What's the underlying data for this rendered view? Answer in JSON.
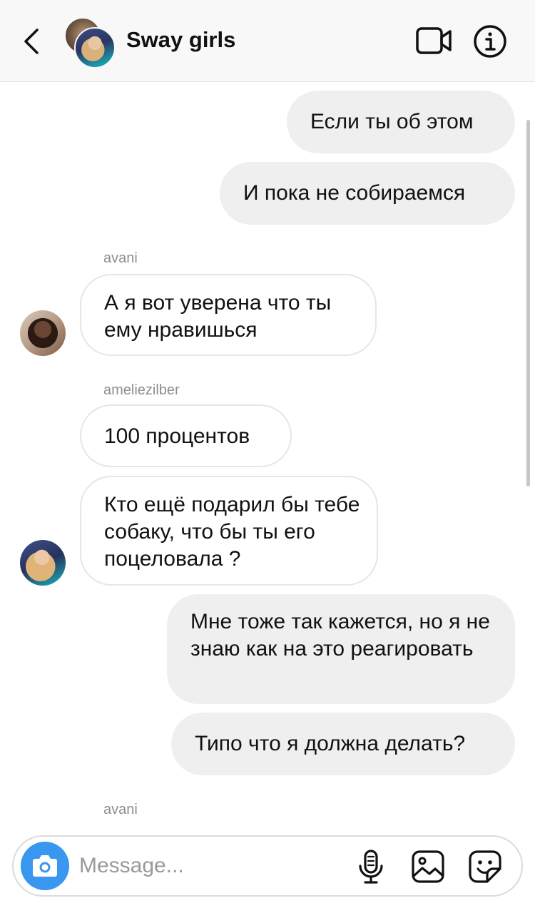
{
  "header": {
    "title": "Sway girls",
    "back_icon": "chevron-left-icon",
    "video_icon": "video-camera-icon",
    "info_icon": "info-icon"
  },
  "messages": [
    {
      "direction": "outgoing",
      "text": "Если ты об этом"
    },
    {
      "direction": "outgoing",
      "text": "И пока не собираемся"
    },
    {
      "direction": "incoming",
      "sender": "avani",
      "text": "А я вот уверена что ты ему нравишься"
    },
    {
      "direction": "incoming",
      "sender": "ameliezilber",
      "text": "100 процентов"
    },
    {
      "direction": "incoming",
      "sender": "ameliezilber",
      "text": "Кто ещё подарил бы тебе собаку, что бы ты его поцеловала ?"
    },
    {
      "direction": "outgoing",
      "text": "Мне тоже так кажется, но я не знаю как на это реагировать"
    },
    {
      "direction": "outgoing",
      "text": "Типо что я должна делать?"
    }
  ],
  "typing_sender": "avani",
  "composer": {
    "placeholder": "Message...",
    "value": "",
    "camera_icon": "camera-icon",
    "mic_icon": "microphone-icon",
    "gallery_icon": "image-icon",
    "sticker_icon": "sticker-icon"
  },
  "colors": {
    "camera_button": "#3a97f0",
    "outgoing_bubble": "#efefef",
    "incoming_border": "#e6e6e6",
    "sender_label": "#8e8e8e"
  }
}
